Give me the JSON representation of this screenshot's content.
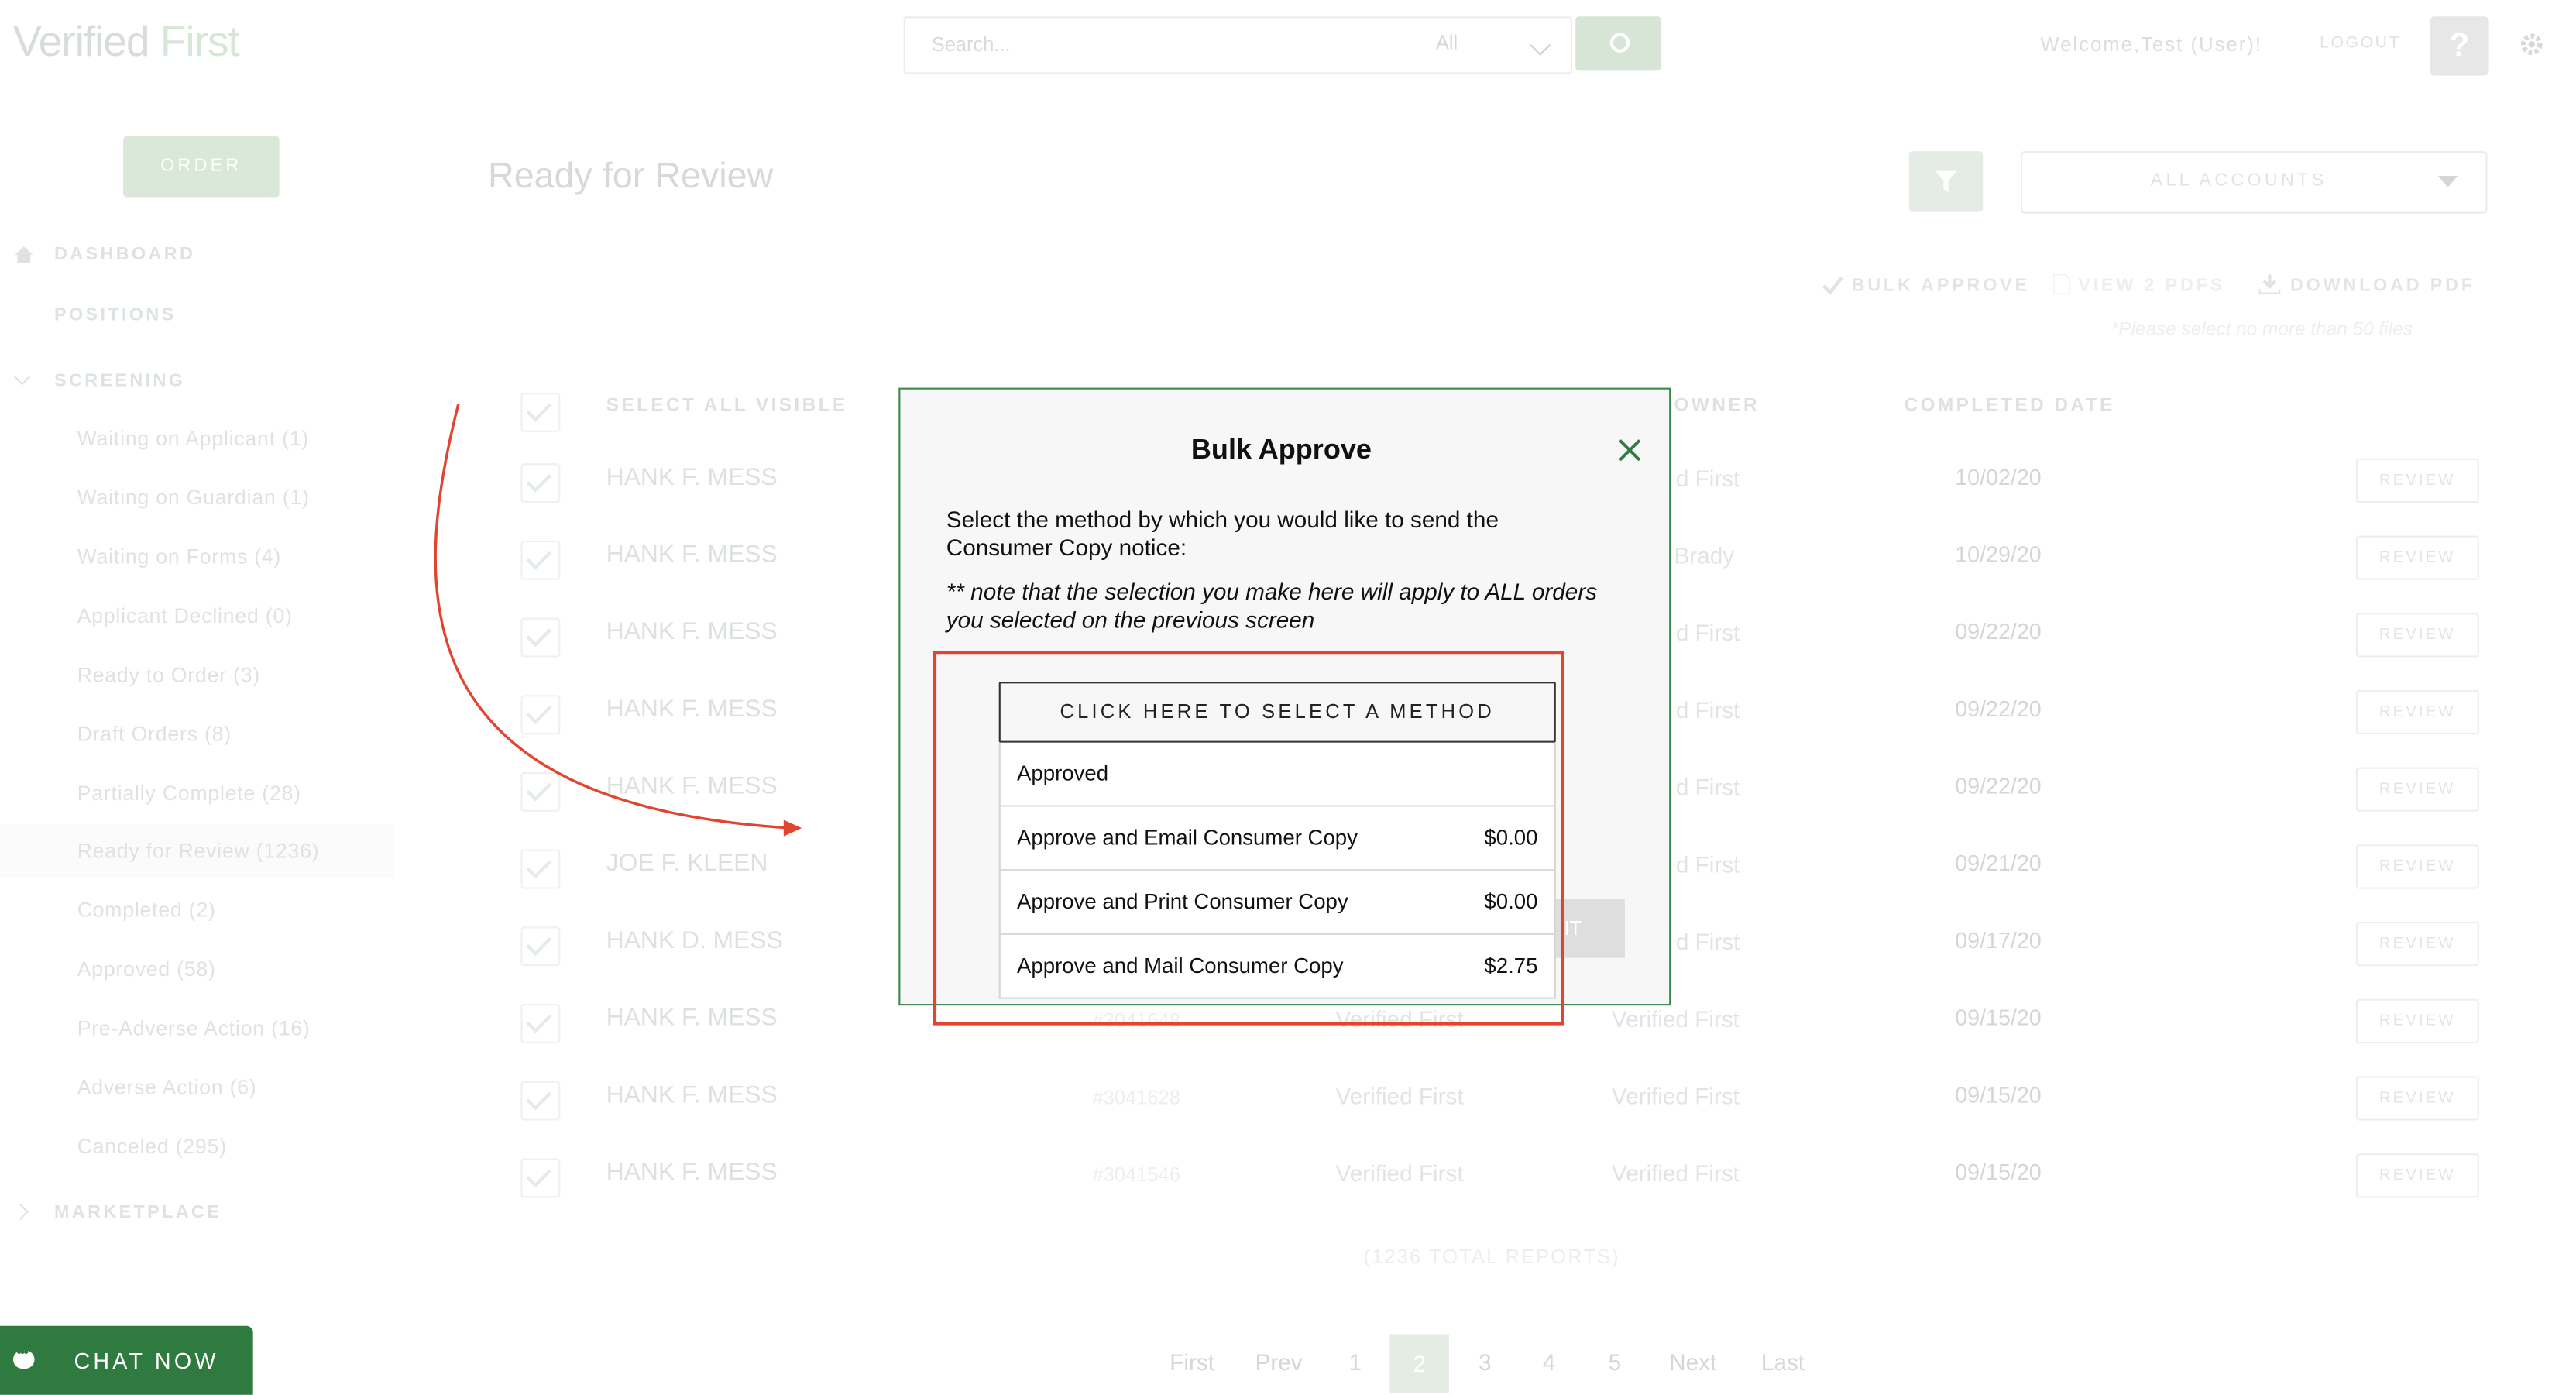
{
  "header": {
    "logo_verified": "Verified",
    "logo_first": "First",
    "search_placeholder": "Search...",
    "search_scope": "All",
    "welcome": "Welcome,Test (User)!",
    "logout": "LOGOUT",
    "help": "?"
  },
  "sidebar": {
    "order_button": "ORDER",
    "dashboard": "DASHBOARD",
    "positions": "POSITIONS",
    "screening": "SCREENING",
    "screening_items": [
      "Waiting on Applicant (1)",
      "Waiting on Guardian (1)",
      "Waiting on Forms (4)",
      "Applicant Declined (0)",
      "Ready to Order (3)",
      "Draft Orders (8)",
      "Partially Complete (28)",
      "Ready for Review (1236)",
      "Completed (2)",
      "Approved (58)",
      "Pre-Adverse Action (16)",
      "Adverse Action (6)",
      "Canceled (295)"
    ],
    "marketplace": "MARKETPLACE"
  },
  "main": {
    "title": "Ready for Review",
    "accounts": "ALL ACCOUNTS",
    "bulk_approve": "BULK APPROVE",
    "view_pdfs": "VIEW 2 PDFS",
    "download_pdf": "DOWNLOAD PDF",
    "hint": "*Please select no more than 50 files",
    "col_select_all": "SELECT ALL VISIBLE",
    "col_owner": "OWNER",
    "col_completed": "COMPLETED DATE",
    "review_label": "REVIEW",
    "rows": [
      {
        "name": "HANK F. MESS",
        "num": "",
        "company": "",
        "owner": "Verified First",
        "date": "10/02/20"
      },
      {
        "name": "HANK F. MESS",
        "num": "",
        "company": "",
        "owner": "Brady",
        "date": "10/29/20"
      },
      {
        "name": "HANK F. MESS",
        "num": "",
        "company": "",
        "owner": "Verified First",
        "date": "09/22/20"
      },
      {
        "name": "HANK F. MESS",
        "num": "",
        "company": "",
        "owner": "Verified First",
        "date": "09/22/20"
      },
      {
        "name": "HANK F. MESS",
        "num": "",
        "company": "",
        "owner": "Verified First",
        "date": "09/22/20"
      },
      {
        "name": "JOE F. KLEEN",
        "num": "",
        "company": "",
        "owner": "Verified First",
        "date": "09/21/20"
      },
      {
        "name": "HANK D. MESS",
        "num": "",
        "company": "",
        "owner": "Verified First",
        "date": "09/17/20"
      },
      {
        "name": "HANK F. MESS",
        "num": "#3041648",
        "company": "Verified First",
        "owner": "Verified First",
        "date": "09/15/20"
      },
      {
        "name": "HANK F. MESS",
        "num": "#3041628",
        "company": "Verified First",
        "owner": "Verified First",
        "date": "09/15/20"
      },
      {
        "name": "HANK F. MESS",
        "num": "#3041546",
        "company": "Verified First",
        "owner": "Verified First",
        "date": "09/15/20"
      }
    ],
    "total": "(1236 TOTAL REPORTS)"
  },
  "pagination": {
    "first": "First",
    "prev": "Prev",
    "pages": [
      "1",
      "2",
      "3",
      "4",
      "5"
    ],
    "current": "2",
    "next": "Next",
    "last": "Last"
  },
  "chat": {
    "label": "CHAT NOW"
  },
  "modal": {
    "title": "Bulk Approve",
    "description": "Select the method by which you would like to send the Consumer Copy notice:",
    "note": "** note that the selection you make here will apply to ALL orders you selected on the previous screen",
    "dropdown_header": "CLICK HERE TO SELECT A METHOD",
    "options": [
      {
        "label": "Approved",
        "price": ""
      },
      {
        "label": "Approve and Email Consumer Copy",
        "price": "$0.00"
      },
      {
        "label": "Approve and Print Consumer Copy",
        "price": "$0.00"
      },
      {
        "label": "Approve and Mail Consumer Copy",
        "price": "$2.75"
      }
    ],
    "hidden_button_fragment": "IT"
  },
  "colors": {
    "accent_green": "#2f7a3f",
    "annotation_red": "#e1452f"
  }
}
